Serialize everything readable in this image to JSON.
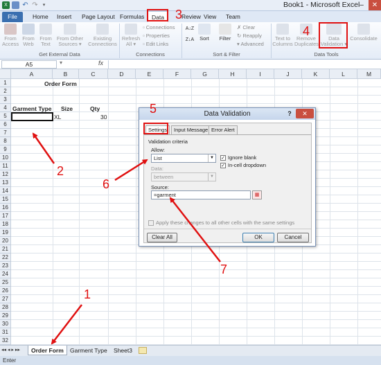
{
  "titlebar": {
    "title": "Book1 - Microsoft Excel",
    "minimize": "–",
    "close": "✕",
    "qat_icons": [
      "excel-icon",
      "save-icon",
      "undo-icon",
      "redo-icon"
    ]
  },
  "tabs": [
    {
      "label": "File"
    },
    {
      "label": "Home"
    },
    {
      "label": "Insert"
    },
    {
      "label": "Page Layout"
    },
    {
      "label": "Formulas"
    },
    {
      "label": "Data"
    },
    {
      "label": "Review"
    },
    {
      "label": "View"
    },
    {
      "label": "Team"
    }
  ],
  "ribbon": {
    "get_external": {
      "buttons": [
        {
          "line1": "From",
          "line2": "Access"
        },
        {
          "line1": "From",
          "line2": "Web"
        },
        {
          "line1": "From",
          "line2": "Text"
        },
        {
          "line1": "From Other",
          "line2": "Sources ▾"
        },
        {
          "line1": "Existing",
          "line2": "Connections"
        }
      ],
      "label": "Get External Data"
    },
    "connections": {
      "refresh": {
        "line1": "Refresh",
        "line2": "All ▾"
      },
      "items": [
        "Connections",
        "Properties",
        "Edit Links"
      ],
      "label": "Connections"
    },
    "sort_filter": {
      "sort": "Sort",
      "filter": "Filter",
      "items": [
        "Clear",
        "Reapply",
        "Advanced"
      ],
      "label": "Sort & Filter"
    },
    "data_tools": {
      "buttons": [
        {
          "line1": "Text to",
          "line2": "Columns"
        },
        {
          "line1": "Remove",
          "line2": "Duplicates"
        },
        {
          "line1": "Data",
          "line2": "Validation ▾"
        },
        {
          "line1": "Consolidate",
          "line2": ""
        }
      ],
      "label": "Data Tools"
    }
  },
  "formula_bar": {
    "name_box": "A5",
    "fx": "fx"
  },
  "columns": [
    "A",
    "B",
    "C",
    "D",
    "E",
    "F",
    "G",
    "H",
    "I",
    "J",
    "K",
    "L",
    "M"
  ],
  "rows": [
    "1",
    "2",
    "3",
    "4",
    "5",
    "6",
    "7",
    "8",
    "9",
    "10",
    "11",
    "12",
    "13",
    "14",
    "15",
    "16",
    "17",
    "18",
    "19",
    "20",
    "21",
    "22",
    "23",
    "24",
    "25",
    "26",
    "27",
    "28",
    "29",
    "30",
    "31",
    "32"
  ],
  "cells": {
    "title": "Order Form",
    "h_garment": "Garment Type",
    "h_size": "Size",
    "h_qty": "Qty",
    "b5": "XL",
    "c5": "30"
  },
  "sheets": {
    "nav": "◂◂ ◂ ▸ ▸▸",
    "tabs": [
      "Order Form",
      "Garment Type",
      "Sheet3"
    ]
  },
  "status": {
    "text": "Enter"
  },
  "dialog": {
    "title": "Data Validation",
    "help": "?",
    "close": "✕",
    "tabs": [
      "Settings",
      "Input Message",
      "Error Alert"
    ],
    "criteria_label": "Validation criteria",
    "allow_label": "Allow:",
    "allow_value": "List",
    "ignore_blank": "Ignore blank",
    "in_cell_dropdown": "In-cell dropdown",
    "data_label": "Data:",
    "data_value": "between",
    "source_label": "Source:",
    "source_value": "=garment",
    "apply_all": "Apply these changes to all other cells with the same settings",
    "clear_all": "Clear All",
    "ok": "OK",
    "cancel": "Cancel"
  },
  "annotations": [
    "1",
    "2",
    "3",
    "4",
    "5",
    "6",
    "7"
  ],
  "colors": {
    "annotation": "#e01010",
    "file_tab": "#3a6fb0"
  }
}
